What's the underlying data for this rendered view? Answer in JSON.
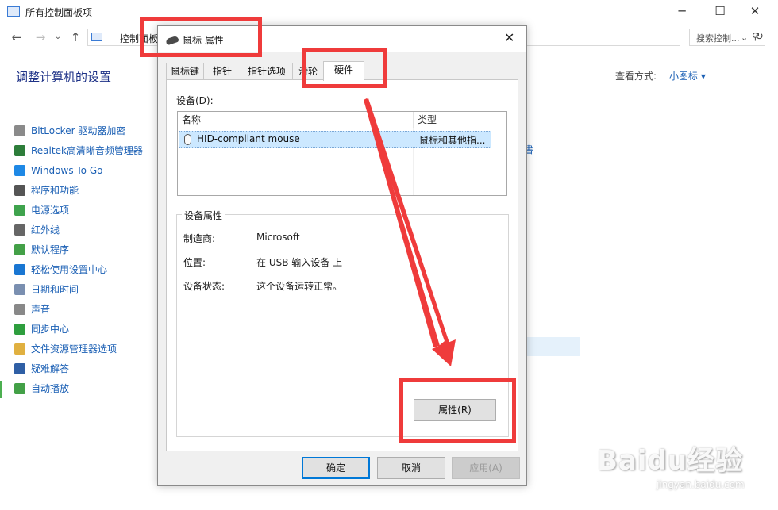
{
  "control_panel": {
    "window_title": "所有控制面板项",
    "address_text": "控制面板",
    "search_placeholder": "搜索控制...",
    "heading": "调整计算机的设置",
    "view_by_label": "查看方式:",
    "view_by_value": "小图标",
    "right_fragment": "書",
    "items": [
      {
        "label": "BitLocker 驱动器加密",
        "color": "#8a8a8a"
      },
      {
        "label": "Realtek高清晰音频管理器",
        "color": "#2d7d3a"
      },
      {
        "label": "Windows To Go",
        "color": "#1e88e5"
      },
      {
        "label": "程序和功能",
        "color": "#555555"
      },
      {
        "label": "电源选项",
        "color": "#3fa34d"
      },
      {
        "label": "红外线",
        "color": "#666666"
      },
      {
        "label": "默认程序",
        "color": "#43a047"
      },
      {
        "label": "轻松使用设置中心",
        "color": "#1976d2"
      },
      {
        "label": "日期和时间",
        "color": "#7a8fb0"
      },
      {
        "label": "声音",
        "color": "#888888"
      },
      {
        "label": "同步中心",
        "color": "#2e9e3e"
      },
      {
        "label": "文件资源管理器选项",
        "color": "#e0b040"
      },
      {
        "label": "疑难解答",
        "color": "#2f5fa5"
      },
      {
        "label": "自动播放",
        "color": "#43a047"
      }
    ]
  },
  "dialog": {
    "title": "鼠标 属性",
    "tabs": [
      "鼠标键",
      "指针",
      "指针选项",
      "滑轮",
      "硬件"
    ],
    "active_tab": "硬件",
    "devices_label": "设备(D):",
    "columns": [
      "名称",
      "类型"
    ],
    "device": {
      "name": "HID-compliant mouse",
      "type": "鼠标和其他指..."
    },
    "properties_group": "设备属性",
    "properties": [
      {
        "key": "制造商:",
        "value": "Microsoft"
      },
      {
        "key": "位置:",
        "value": "在 USB 输入设备 上"
      },
      {
        "key": "设备状态:",
        "value": "这个设备运转正常。"
      }
    ],
    "properties_button": "属性(R)",
    "ok_button": "确定",
    "cancel_button": "取消",
    "apply_button": "应用(A)"
  },
  "watermark": {
    "logo": "Baidu经验",
    "url": "jingyan.baidu.com"
  },
  "colors": {
    "annotation_red": "#ef3b3b",
    "link_blue": "#1a5fb4",
    "heading_blue": "#1e3287",
    "selection": "#cce8ff"
  }
}
